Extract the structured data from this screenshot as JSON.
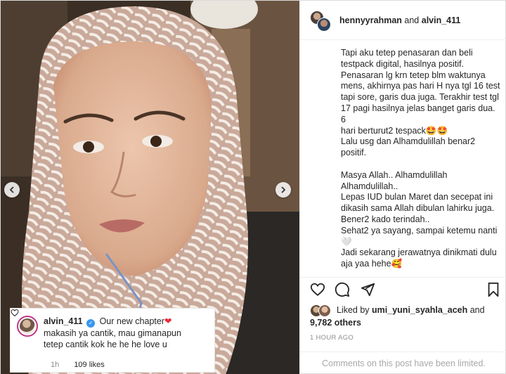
{
  "post": {
    "collaborators_label": {
      "user1": "hennyyrahman",
      "joiner": "and",
      "user2": "alvin_411"
    },
    "caption_lines": [
      "Tapi aku tetep penasaran dan beli",
      "testpack digital, hasilnya positif.",
      "Penasaran lg krn tetep blm waktunya",
      "mens, akhirnya pas hari H nya tgl 16 test",
      "tapi sore, garis dua juga. Terakhir test tgl",
      "17 pagi hasilnya jelas banget garis dua. 6",
      "hari berturut2 tespack🤩🤩",
      "Lalu usg dan Alhamdulillah benar2",
      "positif.",
      "",
      "Masya Allah.. Alhamdulillah",
      "Alhamdulillah..",
      "Lepas IUD bulan Maret dan secepat ini",
      "dikasih sama Allah dibulan lahirku juga.",
      "Bener2 kado terindah..",
      "Sehat2 ya sayang, sampai ketemu nanti",
      "🤍",
      "Jadi sekarang jerawatnya dinikmati dulu",
      "aja yaa hehe🥰"
    ],
    "liked_by_prefix": "Liked by",
    "liked_by_user": "umi_yuni_syahla_aceh",
    "liked_by_suffix": "and",
    "likes_count": "9,782 others",
    "timestamp": "1 HOUR AGO",
    "comments_limited": "Comments on this post have been limited."
  },
  "comment": {
    "username": "alvin_411",
    "line1": "Our new chapter",
    "line1_emoji": "❤",
    "line2": "makasih ya cantik, mau gimanapun",
    "line3": "tetep cantik kok he he he love u",
    "time": "1h",
    "likes": "109 likes"
  },
  "icons": {
    "like": "heart-icon",
    "comment": "comment-icon",
    "share": "share-icon",
    "save": "bookmark-icon",
    "prev": "chevron-left-icon",
    "next": "chevron-right-icon"
  },
  "colors": {
    "verified": "#3897f0",
    "heart": "#ed2b3b",
    "muted": "#8e8e8e"
  }
}
